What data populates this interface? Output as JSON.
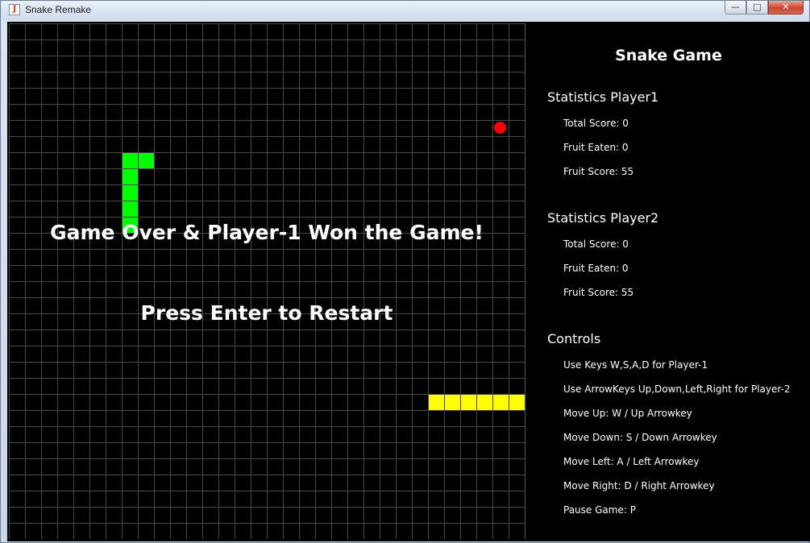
{
  "window": {
    "title": "Snake Remake",
    "app_icon": "java-cup-icon",
    "buttons": {
      "minimize": "—",
      "maximize": "□",
      "close": "✕"
    }
  },
  "board": {
    "grid_columns": 32,
    "grid_rows": 32,
    "colors": {
      "background": "#000000",
      "grid": "#4a4a4a",
      "player1": "#00ff00",
      "player2": "#ffff00",
      "fruit": "#ff0000"
    },
    "snake_player1": [
      [
        7,
        8
      ],
      [
        8,
        8
      ],
      [
        7,
        9
      ],
      [
        7,
        10
      ],
      [
        7,
        11
      ],
      [
        7,
        12
      ]
    ],
    "snake_player2": [
      [
        26,
        23
      ],
      [
        27,
        23
      ],
      [
        28,
        23
      ],
      [
        29,
        23
      ],
      [
        30,
        23
      ],
      [
        31,
        23
      ]
    ],
    "fruit": [
      30,
      6
    ],
    "game_over_message": "Game Over & Player-1 Won the Game!",
    "restart_message": "Press Enter to Restart"
  },
  "panel": {
    "title": "Snake Game",
    "player1": {
      "heading": "Statistics Player1",
      "total_score": "Total Score: 0",
      "fruit_eaten": "Fruit Eaten: 0",
      "fruit_score": "Fruit Score: 55"
    },
    "player2": {
      "heading": "Statistics Player2",
      "total_score": "Total Score: 0",
      "fruit_eaten": "Fruit Eaten: 0",
      "fruit_score": "Fruit Score: 55"
    },
    "controls": {
      "heading": "Controls",
      "lines": [
        "Use Keys W,S,A,D for Player-1",
        "Use ArrowKeys Up,Down,Left,Right for Player-2",
        "Move Up: W / Up Arrowkey",
        "Move Down: S / Down Arrowkey",
        "Move Left: A / Left Arrowkey",
        "Move Right: D / Right Arrowkey",
        "Pause Game: P"
      ]
    }
  }
}
